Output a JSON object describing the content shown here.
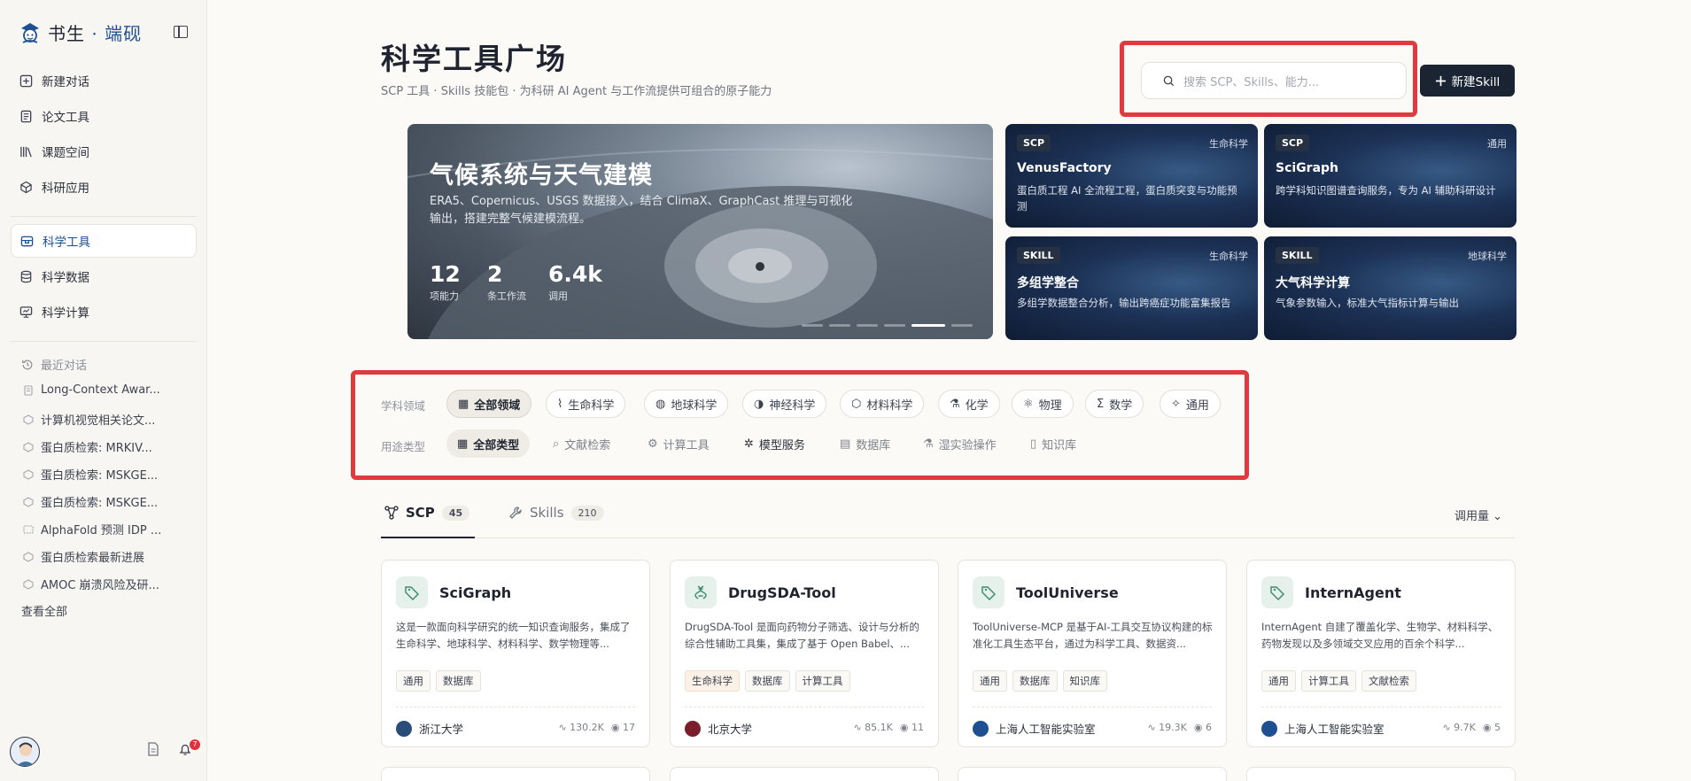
{
  "app": {
    "brand_main": "书生",
    "brand_dot": "·",
    "brand_accent": "端砚"
  },
  "sidebar": {
    "nav": [
      {
        "label": "新建对话",
        "icon": "plus-square-icon"
      },
      {
        "label": "论文工具",
        "icon": "document-icon"
      },
      {
        "label": "课题空间",
        "icon": "library-icon"
      },
      {
        "label": "科研应用",
        "icon": "cube-icon"
      },
      {
        "label": "科学工具",
        "icon": "toolbox-icon",
        "active": true
      },
      {
        "label": "科学数据",
        "icon": "database-icon"
      },
      {
        "label": "科学计算",
        "icon": "monitor-icon"
      }
    ],
    "recent_title": "最近对话",
    "recent": [
      "Long-Context Awar...",
      "计算机视觉相关论文...",
      "蛋白质检索: MRKIV...",
      "蛋白质检索: MSKGE...",
      "蛋白质检索: MSKGE...",
      "AlphaFold 预测 IDP ...",
      "蛋白质检索最新进展",
      "AMOC 崩溃风险及研..."
    ],
    "view_all": "查看全部",
    "notifications": "7"
  },
  "header": {
    "title": "科学工具广场",
    "subtitle": "SCP 工具 · Skills 技能包 · 为科研 AI Agent 与工作流提供可组合的原子能力",
    "search_placeholder": "搜索 SCP、Skills、能力...",
    "new_skill": "新建Skill"
  },
  "hero": {
    "title": "气候系统与天气建模",
    "desc": "ERA5、Copernicus、USGS 数据接入，结合 ClimaX、GraphCast 推理与可视化输出，搭建完整气候建模流程。",
    "stats": [
      {
        "value": "12",
        "label": "项能力"
      },
      {
        "value": "2",
        "label": "条工作流"
      },
      {
        "value": "6.4k",
        "label": "调用"
      }
    ],
    "slides": 6,
    "active_slide": 5
  },
  "featured": [
    {
      "tag": "SCP",
      "domain": "生命科学",
      "title": "VenusFactory",
      "desc": "蛋白质工程 AI 全流程工程，蛋白质突变与功能预测"
    },
    {
      "tag": "SCP",
      "domain": "通用",
      "title": "SciGraph",
      "desc": "跨学科知识图谱查询服务，专为 AI 辅助科研设计"
    },
    {
      "tag": "SKILL",
      "domain": "生命科学",
      "title": "多组学整合",
      "desc": "多组学数据整合分析，输出跨癌症功能富集报告"
    },
    {
      "tag": "SKILL",
      "domain": "地球科学",
      "title": "大气科学计算",
      "desc": "气象参数输入，标准大气指标计算与输出"
    }
  ],
  "filters": {
    "domain_label": "学科领域",
    "domains": [
      {
        "label": "全部领域",
        "icon": "grid-icon"
      },
      {
        "label": "生命科学",
        "icon": "dna-icon"
      },
      {
        "label": "地球科学",
        "icon": "globe-icon"
      },
      {
        "label": "神经科学",
        "icon": "brain-icon"
      },
      {
        "label": "材料科学",
        "icon": "hexagon-icon"
      },
      {
        "label": "化学",
        "icon": "flask-icon"
      },
      {
        "label": "物理",
        "icon": "atom-icon"
      },
      {
        "label": "数学",
        "icon": "sigma-icon"
      },
      {
        "label": "通用",
        "icon": "sparkle-icon"
      }
    ],
    "purpose_label": "用途类型",
    "purposes": [
      {
        "label": "全部类型",
        "icon": "grid-icon"
      },
      {
        "label": "文献检索",
        "icon": "search-icon"
      },
      {
        "label": "计算工具",
        "icon": "gear-icon"
      },
      {
        "label": "模型服务",
        "icon": "network-icon"
      },
      {
        "label": "数据库",
        "icon": "database-icon"
      },
      {
        "label": "湿实验操作",
        "icon": "flask-icon"
      },
      {
        "label": "知识库",
        "icon": "document-icon"
      }
    ]
  },
  "tabs": [
    {
      "label": "SCP",
      "count": "45"
    },
    {
      "label": "Skills",
      "count": "210"
    }
  ],
  "sort_label": "调用量",
  "tools": [
    {
      "name": "SciGraph",
      "desc": "这是一款面向科学研究的统一知识查询服务，集成了生命科学、地球科学、材料科学、数学物理等...",
      "tags": [
        "通用",
        "数据库"
      ],
      "org": "浙江大学",
      "calls": "130.2K",
      "views": "17"
    },
    {
      "name": "DrugSDA-Tool",
      "desc": "DrugSDA-Tool 是面向药物分子筛选、设计与分析的综合性辅助工具集，集成了基于 Open Babel、...",
      "tags": [
        "生命科学",
        "数据库",
        "计算工具"
      ],
      "org": "北京大学",
      "calls": "85.1K",
      "views": "11"
    },
    {
      "name": "ToolUniverse",
      "desc": "ToolUniverse-MCP 是基于AI-工具交互协议构建的标准化工具生态平台，通过为科学工具、数据资...",
      "tags": [
        "通用",
        "数据库",
        "知识库"
      ],
      "org": "上海人工智能实验室",
      "calls": "19.3K",
      "views": "6"
    },
    {
      "name": "InternAgent",
      "desc": "InternAgent 自建了覆盖化学、生物学、材料科学、药物发现以及多领域交叉应用的百余个科学...",
      "tags": [
        "通用",
        "计算工具",
        "文献检索"
      ],
      "org": "上海人工智能实验室",
      "calls": "9.7K",
      "views": "5"
    }
  ]
}
